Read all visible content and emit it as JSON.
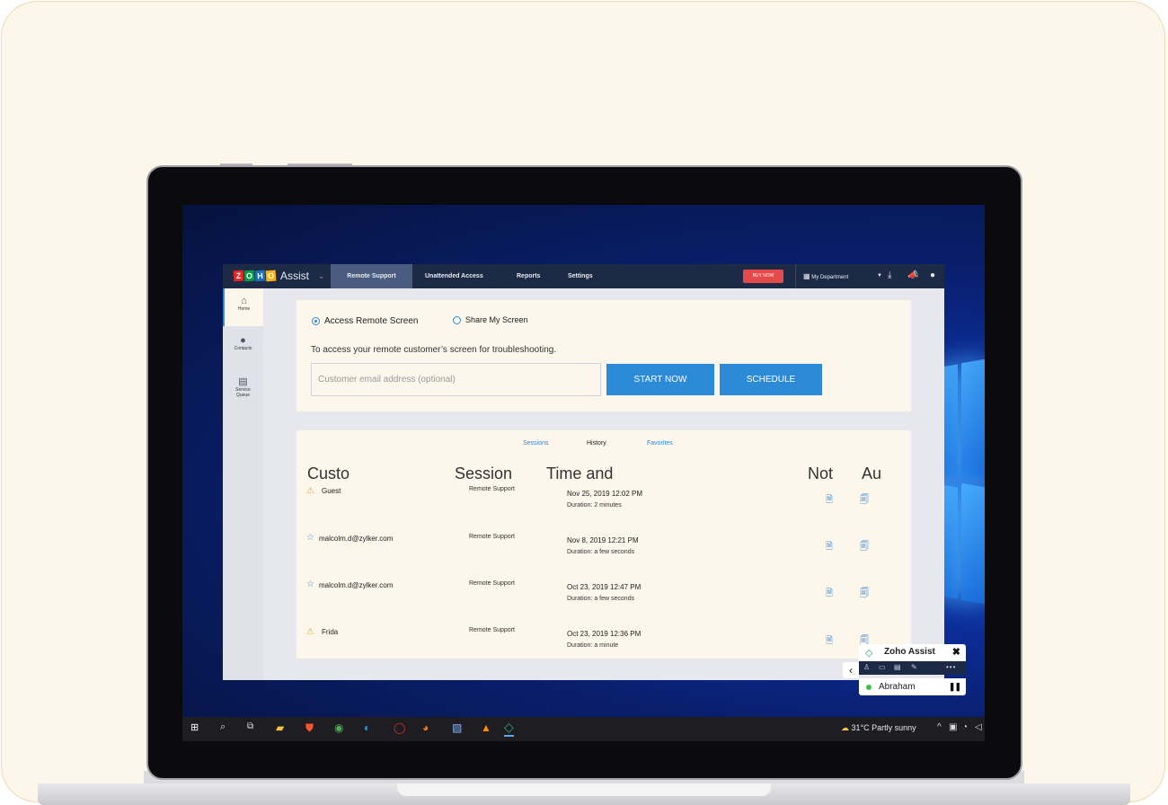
{
  "app": {
    "logo_letters": [
      "Z",
      "O",
      "H",
      "O"
    ],
    "logo_colors": [
      "#e42527",
      "#089949",
      "#226db4",
      "#f9b21d"
    ],
    "product": "Assist",
    "nav_tabs": [
      "Remote Support",
      "Unattended Access",
      "Reports",
      "Settings"
    ],
    "active_tab": "Remote Support",
    "buy_now": "BUY NOW",
    "department": "My Department"
  },
  "sidebar": {
    "items": [
      {
        "label": "Home",
        "icon": "home-icon",
        "active": true
      },
      {
        "label": "Contacts",
        "icon": "user-icon",
        "active": false
      },
      {
        "label": "Service Queue",
        "icon": "queue-icon",
        "active": false
      }
    ]
  },
  "access": {
    "option_remote": "Access Remote Screen",
    "option_share": "Share My Screen",
    "selected": "Access Remote Screen",
    "description": "To access your remote customer’s screen for troubleshooting.",
    "email_placeholder": "Customer email address (optional)",
    "email_value": "",
    "start_button": "START NOW",
    "schedule_button": "SCHEDULE"
  },
  "sessions": {
    "tabs": [
      "Sessions",
      "History",
      "Favorites"
    ],
    "active_tab": "History",
    "columns": [
      "Custo",
      "Session",
      "Time and",
      "Not",
      "Au"
    ],
    "rows": [
      {
        "customer": "Guest",
        "icon": "warning-icon",
        "type": "Remote Support",
        "date": "Nov 25, 2019 12:02 PM",
        "duration": "Duration: 2 minutes"
      },
      {
        "customer": "malcolm.d@zylker.com",
        "icon": "star-icon",
        "type": "Remote Support",
        "date": "Nov 8, 2019 12:21 PM",
        "duration": "Duration: a few seconds"
      },
      {
        "customer": "malcolm.d@zylker.com",
        "icon": "star-icon",
        "type": "Remote Support",
        "date": "Oct 23, 2019 12:47 PM",
        "duration": "Duration: a few seconds"
      },
      {
        "customer": "Frida",
        "icon": "warning-icon",
        "type": "Remote Support",
        "date": "Oct 23, 2019 12:36 PM",
        "duration": "Duration: a minute"
      }
    ]
  },
  "widget": {
    "title": "Zoho Assist",
    "close": "✖",
    "user": "Abraham",
    "user_status_color": "#3cc24a",
    "tools": [
      "user-icon",
      "chat-icon",
      "files-icon",
      "pen-icon",
      "more-icon"
    ]
  },
  "taskbar": {
    "weather": "31°C  Partly sunny",
    "apps": [
      "windows-start-icon",
      "search-icon",
      "task-view-icon",
      "file-explorer-icon",
      "brave-icon",
      "chrome-icon",
      "edge-icon",
      "opera-icon",
      "firefox-icon",
      "notepad-icon",
      "vlc-icon",
      "zoho-assist-icon"
    ]
  },
  "colors": {
    "accent": "#2c8ad6",
    "topbar": "#1d2a45",
    "buy_now": "#e6494b",
    "panel": "#fdf6eb"
  }
}
